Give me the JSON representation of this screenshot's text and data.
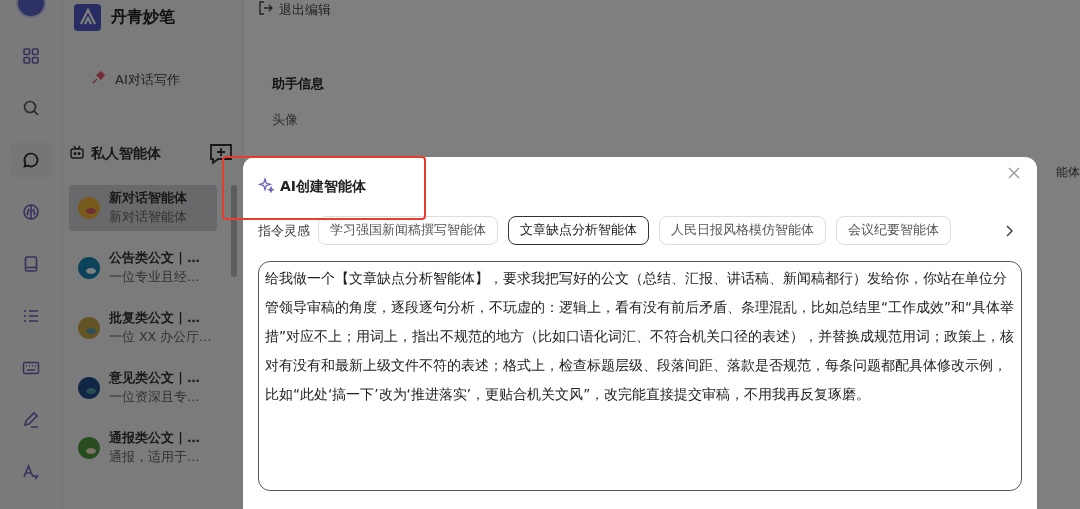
{
  "rail": {
    "items": [
      {
        "selected": false
      },
      {
        "selected": false
      },
      {
        "selected": true
      },
      {
        "selected": false
      },
      {
        "selected": false
      },
      {
        "selected": false
      },
      {
        "selected": false
      },
      {
        "selected": false
      },
      {
        "selected": false
      }
    ]
  },
  "sidebar": {
    "brand": "丹青妙笔",
    "ai_chat": "AI对话写作",
    "section_title": "私人智能体",
    "items": [
      {
        "title": "新对话智能体",
        "subtitle": "新对话智能体",
        "selected": true
      },
      {
        "title": "公告类公文 | …",
        "subtitle": "一位专业且经…",
        "selected": false
      },
      {
        "title": "批复类公文 | …",
        "subtitle": "一位 XX 办公厅…",
        "selected": false
      },
      {
        "title": "意见类公文 | …",
        "subtitle": "一位资深且专…",
        "selected": false
      },
      {
        "title": "通报类公文 | …",
        "subtitle": "通报，适用于…",
        "selected": false
      }
    ]
  },
  "main": {
    "exit_edit": "退出编辑",
    "section_title": "助手信息",
    "avatar_label": "头像",
    "right_text": "能体"
  },
  "dialog": {
    "title": "AI创建智能体",
    "highlighted": true,
    "inspiration_label": "指令灵感",
    "chips": [
      {
        "label": "学习强国新闻稿撰写智能体",
        "selected": false
      },
      {
        "label": "文章缺点分析智能体",
        "selected": true
      },
      {
        "label": "人民日报风格模仿智能体",
        "selected": false
      },
      {
        "label": "会议纪要智能体",
        "selected": false
      }
    ],
    "prompt": "给我做一个【文章缺点分析智能体】，要求我把写好的公文（总结、汇报、讲话稿、新闻稿都行）发给你，你站在单位分管领导审稿的角度，逐段逐句分析，不玩虚的：逻辑上，看有没有前后矛盾、条理混乱，比如总结里“工作成效”和“具体举措”对应不上；用词上，指出不规范的地方（比如口语化词汇、不符合机关口径的表述），并替换成规范用词；政策上，核对有没有和最新上级文件不符的表述；格式上，检查标题层级、段落间距、落款是否规范，每条问题都配具体修改示例，比如“此处‘搞一下’改为‘推进落实’，更贴合机关文风”，改完能直接提交审稿，不用我再反复琢磨。"
  }
}
